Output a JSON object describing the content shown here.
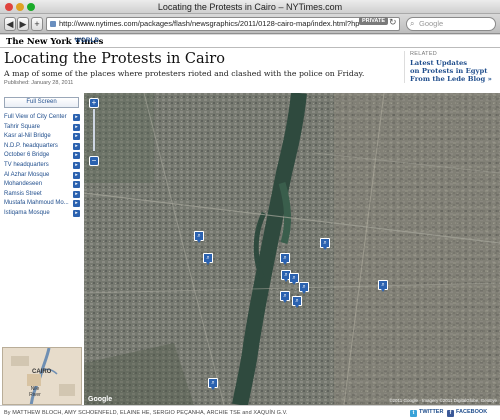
{
  "window": {
    "title": "Locating the Protests in Cairo – NYTimes.com"
  },
  "toolbar": {
    "back": "◀",
    "forward": "▶",
    "add": "+",
    "url": "http://www.nytimes.com/packages/flash/newsgraphics/2011/0128-cairo-map/index.html?hp",
    "private_badge": "PRIVATE",
    "reload": "↻",
    "search_placeholder": "Google"
  },
  "masthead": {
    "logo": "The New York Times",
    "section": "WORLD"
  },
  "article": {
    "headline": "Locating the Protests in Cairo",
    "summary": "A map of some of the places where protesters rioted and clashed with the police on Friday.",
    "published": "Published: January 28, 2011"
  },
  "related": {
    "label": "RELATED",
    "links": [
      "Latest Updates",
      "on Protests in Egypt",
      "From the Lede Blog »"
    ]
  },
  "sidebar": {
    "fullscreen_label": "Full Screen",
    "locations": [
      "Full View of City Center",
      "Tahrir Square",
      "Kasr al-Nil Bridge",
      "N.D.P. headquarters",
      "October 6 Bridge",
      "TV headquarters",
      "Al Azhar Mosque",
      "Mohandeseen",
      "Ramsis Street",
      "Mustafa Mahmoud Mo...",
      "Istiqama Mosque"
    ],
    "inset_labels": {
      "city": "CAIRO",
      "river": "Nile River"
    }
  },
  "map": {
    "zoom_in": "+",
    "zoom_out": "−",
    "marker_count": 11,
    "copyright": "©2011 Google · Imagery ©2011 DigitalGlobe, GeoEye",
    "google_badge": "Google"
  },
  "footer": {
    "byline": "By MATTHEW BLOCH, AMY SCHOENFELD, ELAINE HE, SERGIO PEÇANHA, ARCHIE TSE and XAQUÍN G.V.",
    "twitter": "TWITTER",
    "facebook": "FACEBOOK"
  },
  "colors": {
    "link": "#1f4d8c",
    "marker": "#2b62b0",
    "nile": "#2f4a3e"
  }
}
